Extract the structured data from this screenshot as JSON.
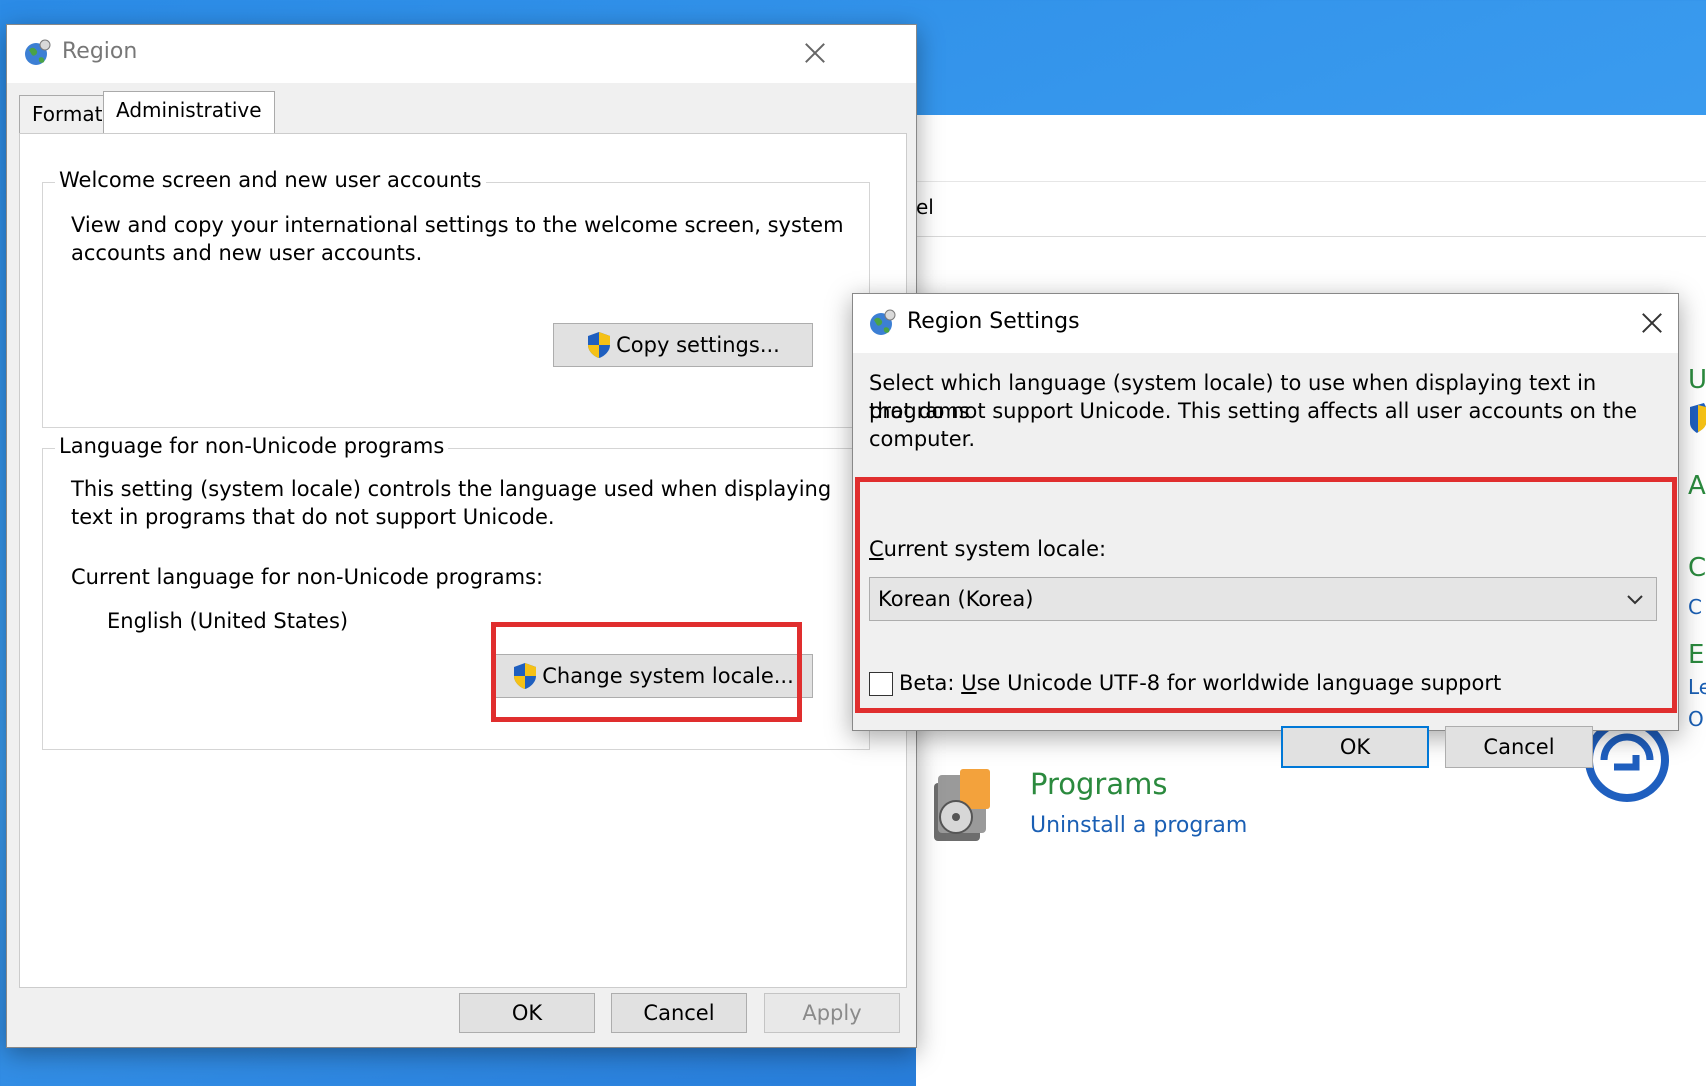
{
  "control_panel": {
    "address_partial": "el",
    "programs_title": "Programs",
    "programs_link": "Uninstall a program",
    "right_letters": [
      "U",
      "A",
      "C",
      "C",
      "E",
      "Le",
      "O"
    ]
  },
  "region_window": {
    "title": "Region",
    "tabs": [
      {
        "label": "Formats"
      },
      {
        "label": "Administrative"
      }
    ],
    "welcome_group": {
      "title": "Welcome screen and new user accounts",
      "line1": "View and copy your international settings to the welcome screen, system",
      "line2": "accounts and new user accounts.",
      "copy_button": "Copy settings..."
    },
    "non_unicode_group": {
      "title": "Language for non-Unicode programs",
      "line1": "This setting (system locale) controls the language used when displaying",
      "line2": "text in programs that do not support Unicode.",
      "current_label": "Current language for non-Unicode programs:",
      "current_value": "English (United States)",
      "change_button": "Change system locale..."
    },
    "footer": {
      "ok": "OK",
      "cancel": "Cancel",
      "apply": "Apply"
    }
  },
  "region_settings_dialog": {
    "title": "Region Settings",
    "desc_line1": "Select which language (system locale) to use when displaying text in programs",
    "desc_line2": "that do not support Unicode. This setting affects all user accounts on the",
    "desc_line3": "computer.",
    "locale_label_first": "C",
    "locale_label_rest": "urrent system locale:",
    "locale_value": "Korean (Korea)",
    "beta_prefix": "Beta: ",
    "beta_u": "U",
    "beta_rest": "se Unicode UTF-8 for worldwide language support",
    "beta_checked": false,
    "ok": "OK",
    "cancel": "Cancel"
  },
  "colors": {
    "highlight": "#e02e2e",
    "link": "#1a5fb4",
    "programs_green": "#2b8a3e",
    "desktop_blue": "#2b8be6"
  },
  "icons": [
    "globe-icon",
    "close-icon",
    "shield-icon",
    "chevron-down-icon",
    "programs-icon",
    "update-circle-icon"
  ]
}
